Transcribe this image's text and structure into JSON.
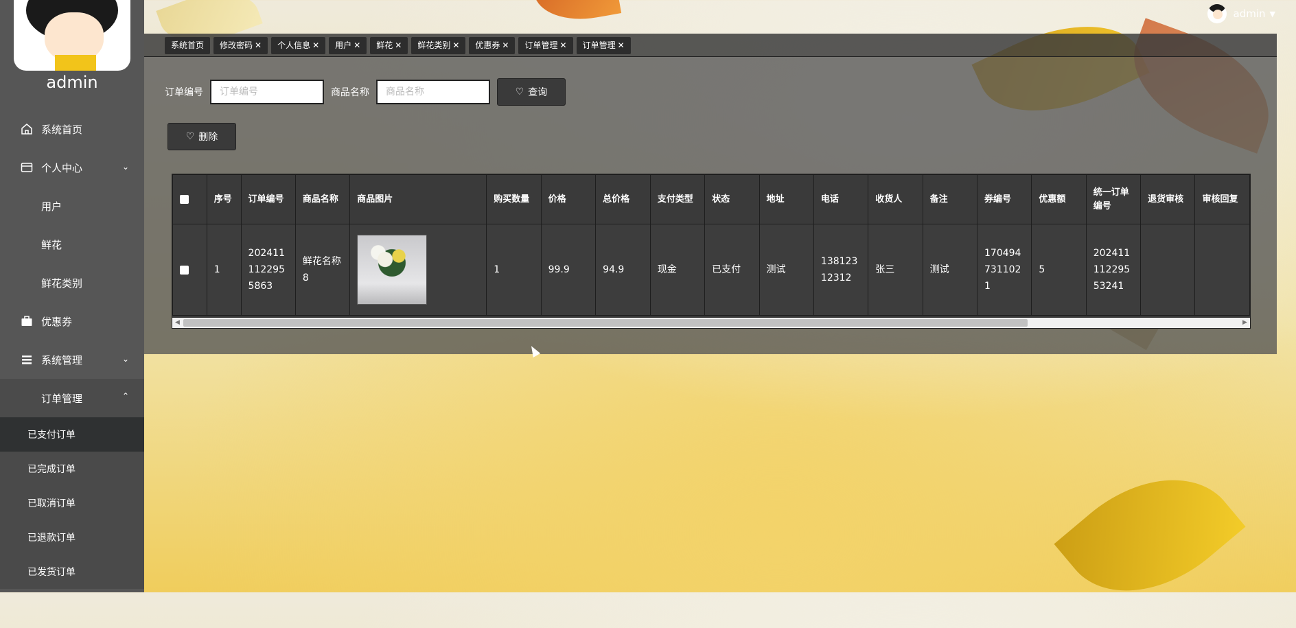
{
  "user": {
    "name": "admin"
  },
  "sidebar": {
    "items": [
      {
        "label": "系统首页",
        "icon": "home-icon"
      },
      {
        "label": "个人中心",
        "icon": "id-card-icon",
        "expandable": true
      },
      {
        "label": "用户",
        "icon": "grid-icon"
      },
      {
        "label": "鲜花",
        "icon": "grid-icon"
      },
      {
        "label": "鲜花类别",
        "icon": "grid-icon"
      },
      {
        "label": "优惠券",
        "icon": "briefcase-icon"
      },
      {
        "label": "系统管理",
        "icon": "list-icon",
        "expandable": true
      },
      {
        "label": "订单管理",
        "icon": "grid-icon",
        "expanded": true
      }
    ],
    "submenu": [
      {
        "label": "已支付订单",
        "active": true
      },
      {
        "label": "已完成订单"
      },
      {
        "label": "已取消订单"
      },
      {
        "label": "已退款订单"
      },
      {
        "label": "已发货订单"
      }
    ]
  },
  "tabs": [
    {
      "label": "系统首页",
      "closable": false
    },
    {
      "label": "修改密码",
      "closable": true
    },
    {
      "label": "个人信息",
      "closable": true
    },
    {
      "label": "用户",
      "closable": true
    },
    {
      "label": "鲜花",
      "closable": true
    },
    {
      "label": "鲜花类别",
      "closable": true
    },
    {
      "label": "优惠券",
      "closable": true
    },
    {
      "label": "订单管理",
      "closable": true
    },
    {
      "label": "订单管理",
      "closable": true
    }
  ],
  "search": {
    "order_label": "订单编号",
    "order_placeholder": "订单编号",
    "goods_label": "商品名称",
    "goods_placeholder": "商品名称",
    "query_button": "查询",
    "delete_button": "删除"
  },
  "table": {
    "headers": [
      "序号",
      "订单编号",
      "商品名称",
      "商品图片",
      "购买数量",
      "价格",
      "总价格",
      "支付类型",
      "状态",
      "地址",
      "电话",
      "收货人",
      "备注",
      "券编号",
      "优惠额",
      "统一订单编号",
      "退货审核",
      "审核回复"
    ],
    "rows": [
      {
        "index": "1",
        "order_no": "2024111122955863",
        "goods_name": "鲜花名称8",
        "quantity": "1",
        "price": "99.9",
        "total": "94.9",
        "pay_type": "现金",
        "status": "已支付",
        "address": "测试",
        "phone": "13812312312",
        "receiver": "张三",
        "remark": "测试",
        "coupon_no": "1704947311021",
        "discount": "5",
        "unified_no": "2024111122955324​1",
        "return_review": "",
        "review_reply": ""
      }
    ]
  }
}
